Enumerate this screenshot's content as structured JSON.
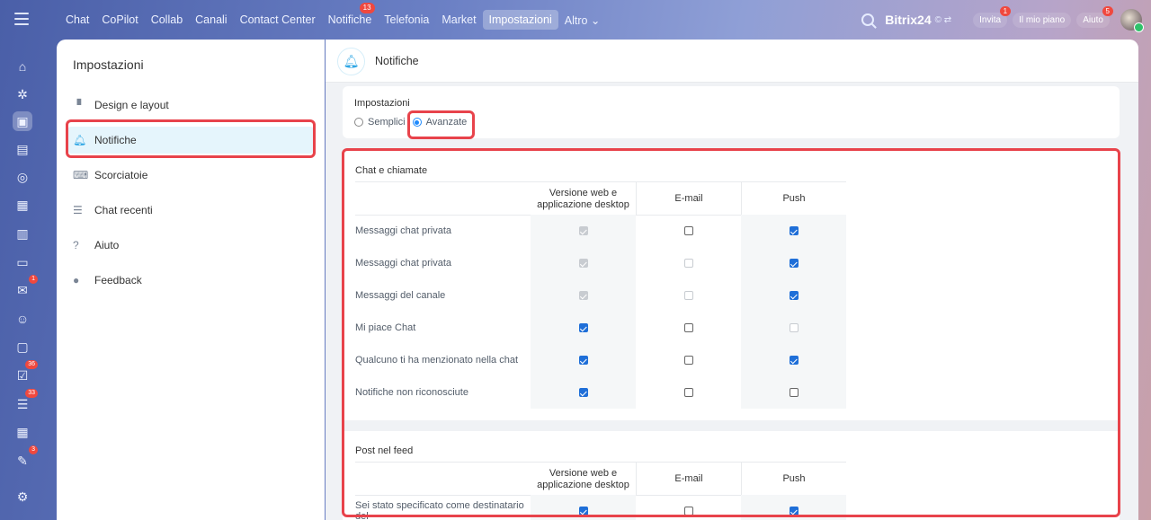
{
  "topbar": {
    "nav": [
      {
        "label": "Chat"
      },
      {
        "label": "CoPilot"
      },
      {
        "label": "Collab"
      },
      {
        "label": "Canali"
      },
      {
        "label": "Contact Center"
      },
      {
        "label": "Notifiche",
        "badge": "13"
      },
      {
        "label": "Telefonia"
      },
      {
        "label": "Market"
      },
      {
        "label": "Impostazioni",
        "active": true
      },
      {
        "label": "Altro ⌄"
      }
    ],
    "brand": "Bitrix24",
    "brand_suffix": "© ⇄",
    "invite": {
      "label": "Invita",
      "badge": "1"
    },
    "plan": {
      "label": "Il mio piano"
    },
    "help": {
      "label": "Aiuto",
      "badge": "5"
    }
  },
  "leftbar": {
    "badges": {
      "mail": "1",
      "tasks": "36",
      "feed": "33",
      "notes": "3"
    }
  },
  "settings_sidebar": {
    "title": "Impostazioni",
    "items": [
      {
        "label": "Design e layout",
        "icon": "brush-icon"
      },
      {
        "label": "Notifiche",
        "icon": "bell-icon",
        "active": true
      },
      {
        "label": "Scorciatoie",
        "icon": "keyboard-icon"
      },
      {
        "label": "Chat recenti",
        "icon": "list-icon"
      },
      {
        "label": "Aiuto",
        "icon": "question-icon"
      },
      {
        "label": "Feedback",
        "icon": "chat-bubble-icon"
      }
    ]
  },
  "main": {
    "title": "Notifiche",
    "mode": {
      "label": "Impostazioni",
      "option_simple": "Semplici",
      "option_advanced": "Avanzate",
      "selected": "Avanzate"
    },
    "sections": [
      {
        "title": "Chat e chiamate",
        "columns": [
          "Versione web e applicazione desktop",
          "E-mail",
          "Push"
        ],
        "rows": [
          {
            "label": "Messaggi chat privata",
            "web": "checked-disabled",
            "email": "unchecked",
            "push": "checked"
          },
          {
            "label": "Messaggi chat privata",
            "web": "checked-disabled",
            "email": "disabled",
            "push": "checked"
          },
          {
            "label": "Messaggi del canale",
            "web": "checked-disabled",
            "email": "disabled",
            "push": "checked"
          },
          {
            "label": "Mi piace Chat",
            "web": "checked",
            "email": "unchecked",
            "push": "disabled"
          },
          {
            "label": "Qualcuno ti ha menzionato nella chat",
            "web": "checked",
            "email": "unchecked",
            "push": "checked"
          },
          {
            "label": "Notifiche non riconosciute",
            "web": "checked",
            "email": "unchecked",
            "push": "unchecked"
          }
        ]
      },
      {
        "title": "Post nel feed",
        "columns": [
          "Versione web e applicazione desktop",
          "E-mail",
          "Push"
        ],
        "rows": [
          {
            "label": "Sei stato specificato come destinatario del",
            "web": "checked",
            "email": "unchecked",
            "push": "checked"
          }
        ]
      }
    ]
  },
  "colors": {
    "accent": "#2fa6e4",
    "highlight": "#e8434b",
    "checkbox": "#1f6fd8"
  }
}
